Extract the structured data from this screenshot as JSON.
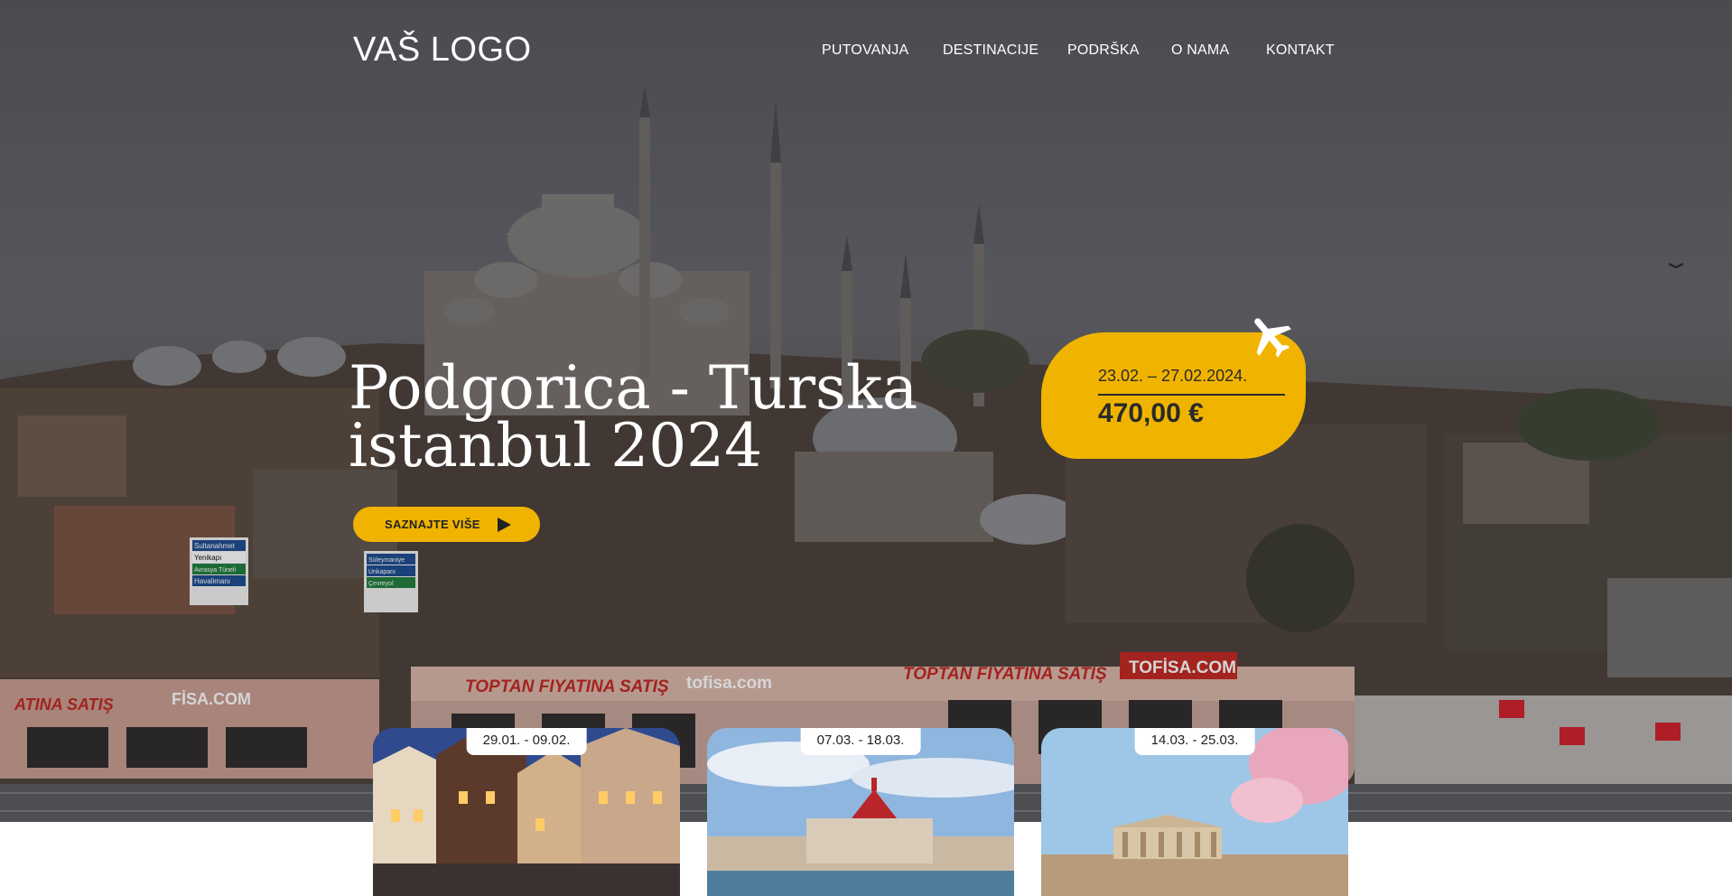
{
  "header": {
    "logo": "VAŠ LOGO",
    "nav": [
      "PUTOVANJA",
      "DESTINACIJE",
      "PODRŠKA",
      "O NAMA",
      "KONTAKT"
    ]
  },
  "hero": {
    "title_line1": "Podgorica - Turska",
    "title_line2": "istanbul 2024",
    "cta_label": "SAZNAJTE VIŠE",
    "cta_icon": "play-icon",
    "banner_texts": [
      "TOPTAN FIYATINA SATIŞ",
      "TOFİSA.COM",
      "TOPTAN FIYATINA SATIŞ",
      "tofisa.com",
      "ATINA SATIŞ",
      "FİSA.COM"
    ],
    "signs": [
      "Sultanahmet",
      "Yenikapı",
      "Avrasya Tüneli",
      "Havalimanı",
      "Süleymaniye",
      "Unkapanı",
      "Çevreyol"
    ]
  },
  "offer": {
    "dates": "23.02. – 27.02.2024.",
    "price": "470,00 €",
    "icon": "airplane-icon"
  },
  "cards": [
    {
      "dates": "29.01. - 09.02."
    },
    {
      "dates": "07.03. - 18.03."
    },
    {
      "dates": "14.03. - 25.03."
    }
  ],
  "colors": {
    "accent": "#f0b400",
    "text_dark": "#2a2a2a",
    "white": "#ffffff"
  }
}
